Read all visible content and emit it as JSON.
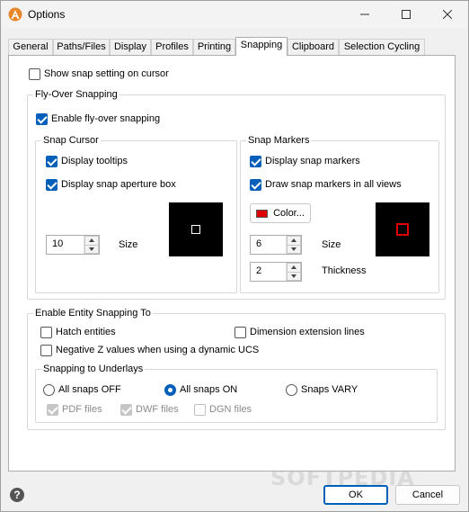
{
  "window": {
    "title": "Options"
  },
  "tabs": [
    "General",
    "Paths/Files",
    "Display",
    "Profiles",
    "Printing",
    "Snapping",
    "Clipboard",
    "Selection Cycling"
  ],
  "show_snap_setting": {
    "label": "Show snap setting on cursor",
    "checked": false
  },
  "flyover": {
    "group_label": "Fly-Over Snapping",
    "enable": {
      "label": "Enable fly-over snapping",
      "checked": true
    },
    "snap_cursor": {
      "group_label": "Snap Cursor",
      "display_tooltips": "Display tooltips",
      "display_aperture": "Display snap aperture box",
      "size_value": "10",
      "size_label": "Size"
    },
    "snap_markers": {
      "group_label": "Snap Markers",
      "display_markers": "Display snap markers",
      "draw_all_views": "Draw snap markers in all views",
      "color_button": "Color...",
      "color": "#e00000",
      "size_value": "6",
      "size_label": "Size",
      "thickness_value": "2",
      "thickness_label": "Thickness"
    }
  },
  "entity_snapping": {
    "group_label": "Enable Entity Snapping To",
    "hatch": "Hatch entities",
    "dimension": "Dimension extension lines",
    "negative_z": "Negative Z values when using a dynamic UCS",
    "underlays": {
      "group_label": "Snapping to Underlays",
      "all_off": "All snaps OFF",
      "all_on": "All snaps ON",
      "vary": "Snaps VARY",
      "selected": "All snaps ON",
      "pdf": "PDF files",
      "dwf": "DWF files",
      "dgn": "DGN files"
    }
  },
  "footer": {
    "ok": "OK",
    "cancel": "Cancel",
    "help_glyph": "?"
  },
  "watermark": "SOFTPEDIA",
  "colors": {
    "accent": "#005fb8",
    "marker_red": "#e00000"
  }
}
